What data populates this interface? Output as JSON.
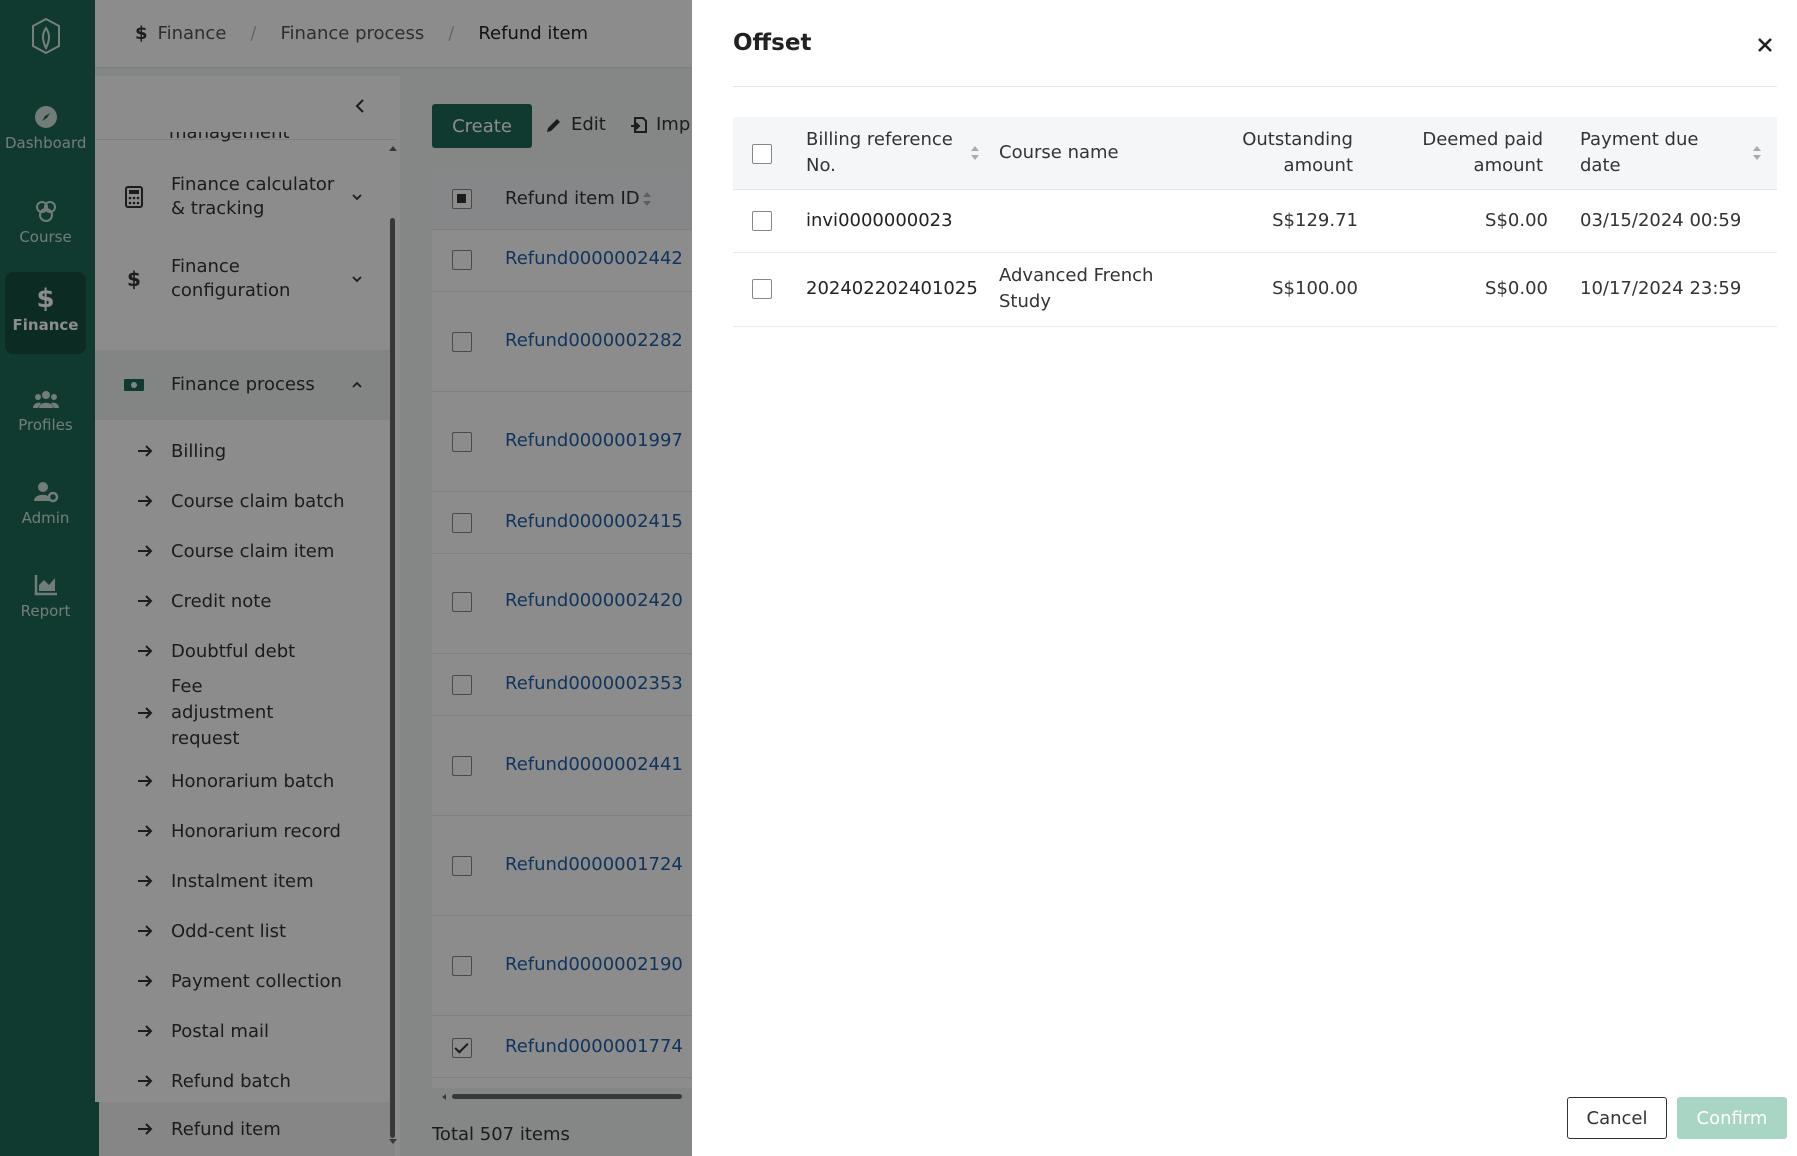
{
  "rail": {
    "items": [
      {
        "label": "Dashboard",
        "icon": "compass-icon"
      },
      {
        "label": "Course",
        "icon": "course-icon"
      },
      {
        "label": "Finance",
        "icon": "dollar-icon"
      },
      {
        "label": "Profiles",
        "icon": "users-icon"
      },
      {
        "label": "Admin",
        "icon": "user-cog-icon"
      },
      {
        "label": "Report",
        "icon": "chart-icon"
      }
    ],
    "active": "Finance"
  },
  "breadcrumb": [
    "Finance",
    "Finance process",
    "Refund item"
  ],
  "sidenav": {
    "cut_item": "management",
    "groups": [
      {
        "label": "Finance calculator & tracking",
        "icon": "calculator-icon"
      },
      {
        "label": "Finance configuration",
        "icon": "dollar-icon"
      },
      {
        "label": "Finance process",
        "icon": "money-icon"
      }
    ],
    "subitems": [
      "Billing",
      "Course claim batch",
      "Course claim item",
      "Credit note",
      "Doubtful debt",
      "Fee adjustment request",
      "Honorarium batch",
      "Honorarium record",
      "Instalment item",
      "Odd-cent list",
      "Payment collection",
      "Postal mail",
      "Refund batch",
      "Refund item"
    ],
    "active_subitem": "Refund item"
  },
  "toolbar": {
    "create": "Create",
    "edit": "Edit",
    "import": "Imp"
  },
  "list": {
    "header": "Refund item ID",
    "rows": [
      "Refund0000002442",
      "Refund0000002282",
      "Refund0000001997",
      "Refund0000002415",
      "Refund0000002420",
      "Refund0000002353",
      "Refund0000002441",
      "Refund0000001724",
      "Refund0000002190",
      "Refund0000001774"
    ],
    "checked": "Refund0000001774",
    "total": "Total 507 items"
  },
  "drawer": {
    "title": "Offset",
    "columns": {
      "ref": "Billing reference No.",
      "course": "Course name",
      "outstanding": "Outstanding amount",
      "deemed": "Deemed paid amount",
      "due": "Payment due date"
    },
    "rows": [
      {
        "ref": "invi0000000023",
        "course": "",
        "outstanding": "S$129.71",
        "deemed": "S$0.00",
        "due": "03/15/2024 00:59"
      },
      {
        "ref": "202402202401025",
        "course": "Advanced French Study",
        "outstanding": "S$100.00",
        "deemed": "S$0.00",
        "due": "10/17/2024 23:59"
      }
    ],
    "cancel": "Cancel",
    "confirm": "Confirm"
  },
  "colors": {
    "brand": "#1e6b57",
    "link": "#1f5fa8",
    "confirm_disabled": "#a8d5c4"
  }
}
